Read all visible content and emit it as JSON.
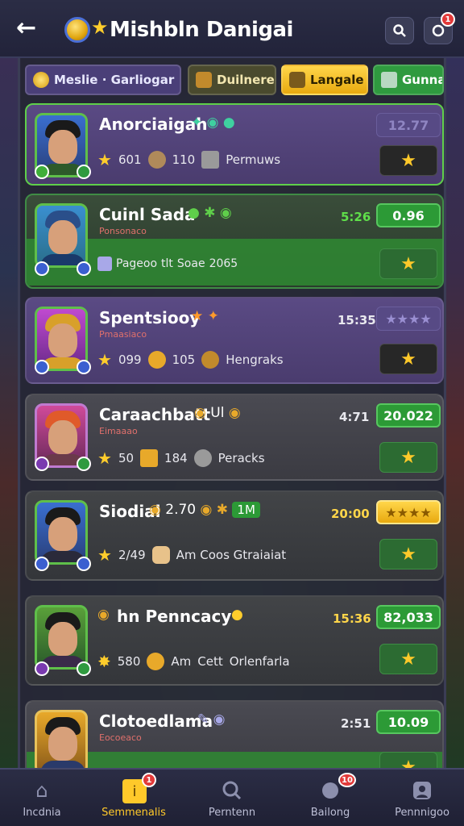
{
  "header": {
    "title": "Mishbln Danigai",
    "back_icon": "arrow-left-icon",
    "search_icon": "search-icon",
    "notification_icon": "bell-icon",
    "notification_badge": "1"
  },
  "filters": [
    {
      "label": "Meslie · Garliogar"
    },
    {
      "label": "Duilnerer"
    },
    {
      "label": "Langale"
    },
    {
      "label": "Gunnaa"
    }
  ],
  "cards": [
    {
      "name": "Anorciaigah",
      "subtitle": "",
      "stats": [
        "601",
        "110",
        "Permuws"
      ],
      "time": "",
      "score": "12.77",
      "score_style": "faded"
    },
    {
      "name": "Cuinl Sada",
      "subtitle": "Ponsonaco",
      "stats": [
        "Pageoo",
        "tlt",
        "Soae",
        "2065"
      ],
      "time": "5:26",
      "score": "0.96",
      "score_style": "green"
    },
    {
      "name": "Spentsiooy",
      "subtitle": "Pmaasiaco",
      "stats": [
        "099",
        "105",
        "Hengraks"
      ],
      "time": "15:35",
      "score": "★★★★",
      "score_style": "faded"
    },
    {
      "name": "Caraachbatt",
      "name_extra": "Ul",
      "subtitle": "Eimaaao",
      "stats": [
        "50",
        "184",
        "Peracks"
      ],
      "time": "4:71",
      "score": "20.022",
      "score_style": "green"
    },
    {
      "name": "Siodial",
      "name_extra": "2.70",
      "name_tag": "1M",
      "subtitle": "",
      "stats": [
        "2/49",
        "Am Coos Gtraiaiat"
      ],
      "time": "20:00",
      "score": "★★★★",
      "score_style": "gold"
    },
    {
      "name": "hn Penncacy",
      "subtitle": "",
      "stats": [
        "580",
        "Am",
        "Cett",
        "Orlenfarla"
      ],
      "time": "15:36",
      "score": "82,033",
      "score_style": "green"
    },
    {
      "name": "Clotoedlama",
      "subtitle": "Eocoeaco",
      "stats": [],
      "time": "2:51",
      "score": "10.09",
      "score_style": "green"
    }
  ],
  "nav": [
    {
      "label": "Incdnia",
      "icon": "home-icon"
    },
    {
      "label": "Semmenalis",
      "icon": "info-icon",
      "badge": "1"
    },
    {
      "label": "Perntenn",
      "icon": "search-icon"
    },
    {
      "label": "Bailong",
      "icon": "chat-icon",
      "badge": "10"
    },
    {
      "label": "Pennnigoo",
      "icon": "user-icon"
    }
  ],
  "colors": {
    "accent": "#ffc92a",
    "green": "#2c9a36",
    "purple": "#5a4a84"
  }
}
